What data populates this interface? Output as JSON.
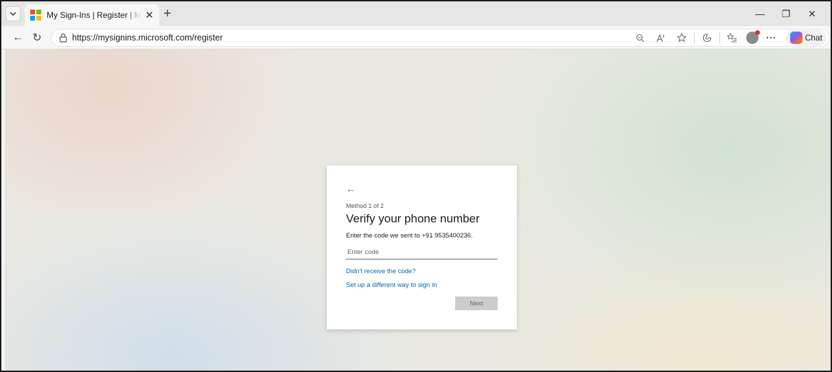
{
  "browser": {
    "tab": {
      "title": "My Sign-Ins | Register | Microsoft",
      "close_glyph": "✕"
    },
    "new_tab_glyph": "+",
    "window_controls": {
      "minimize": "—",
      "restore": "❐",
      "close": "✕"
    },
    "nav": {
      "back_glyph": "←",
      "refresh_glyph": "↻"
    },
    "address": {
      "url": "https://mysignins.microsoft.com/register"
    },
    "toolbar_icons": [
      "zoom-icon",
      "read-aloud-icon",
      "favorite-star-icon",
      "extensions-icon",
      "favorites-list-icon",
      "profile-icon",
      "more-icon"
    ],
    "chat_label": "Chat"
  },
  "card": {
    "back_glyph": "←",
    "method_label": "Method 1 of 2",
    "title": "Verify your phone number",
    "instructions": "Enter the code we sent to +91 9535400236.",
    "code_input": {
      "placeholder": "Enter code",
      "value": ""
    },
    "links": {
      "resend": "Didn't receive the code?",
      "different_method": "Set up a different way to sign in"
    },
    "next_label": "Next"
  },
  "colors": {
    "link": "#0067b8",
    "next_disabled_bg": "#cccccc",
    "ms_red": "#f25022",
    "ms_green": "#7fba00",
    "ms_blue": "#00a4ef",
    "ms_yellow": "#ffb900"
  }
}
